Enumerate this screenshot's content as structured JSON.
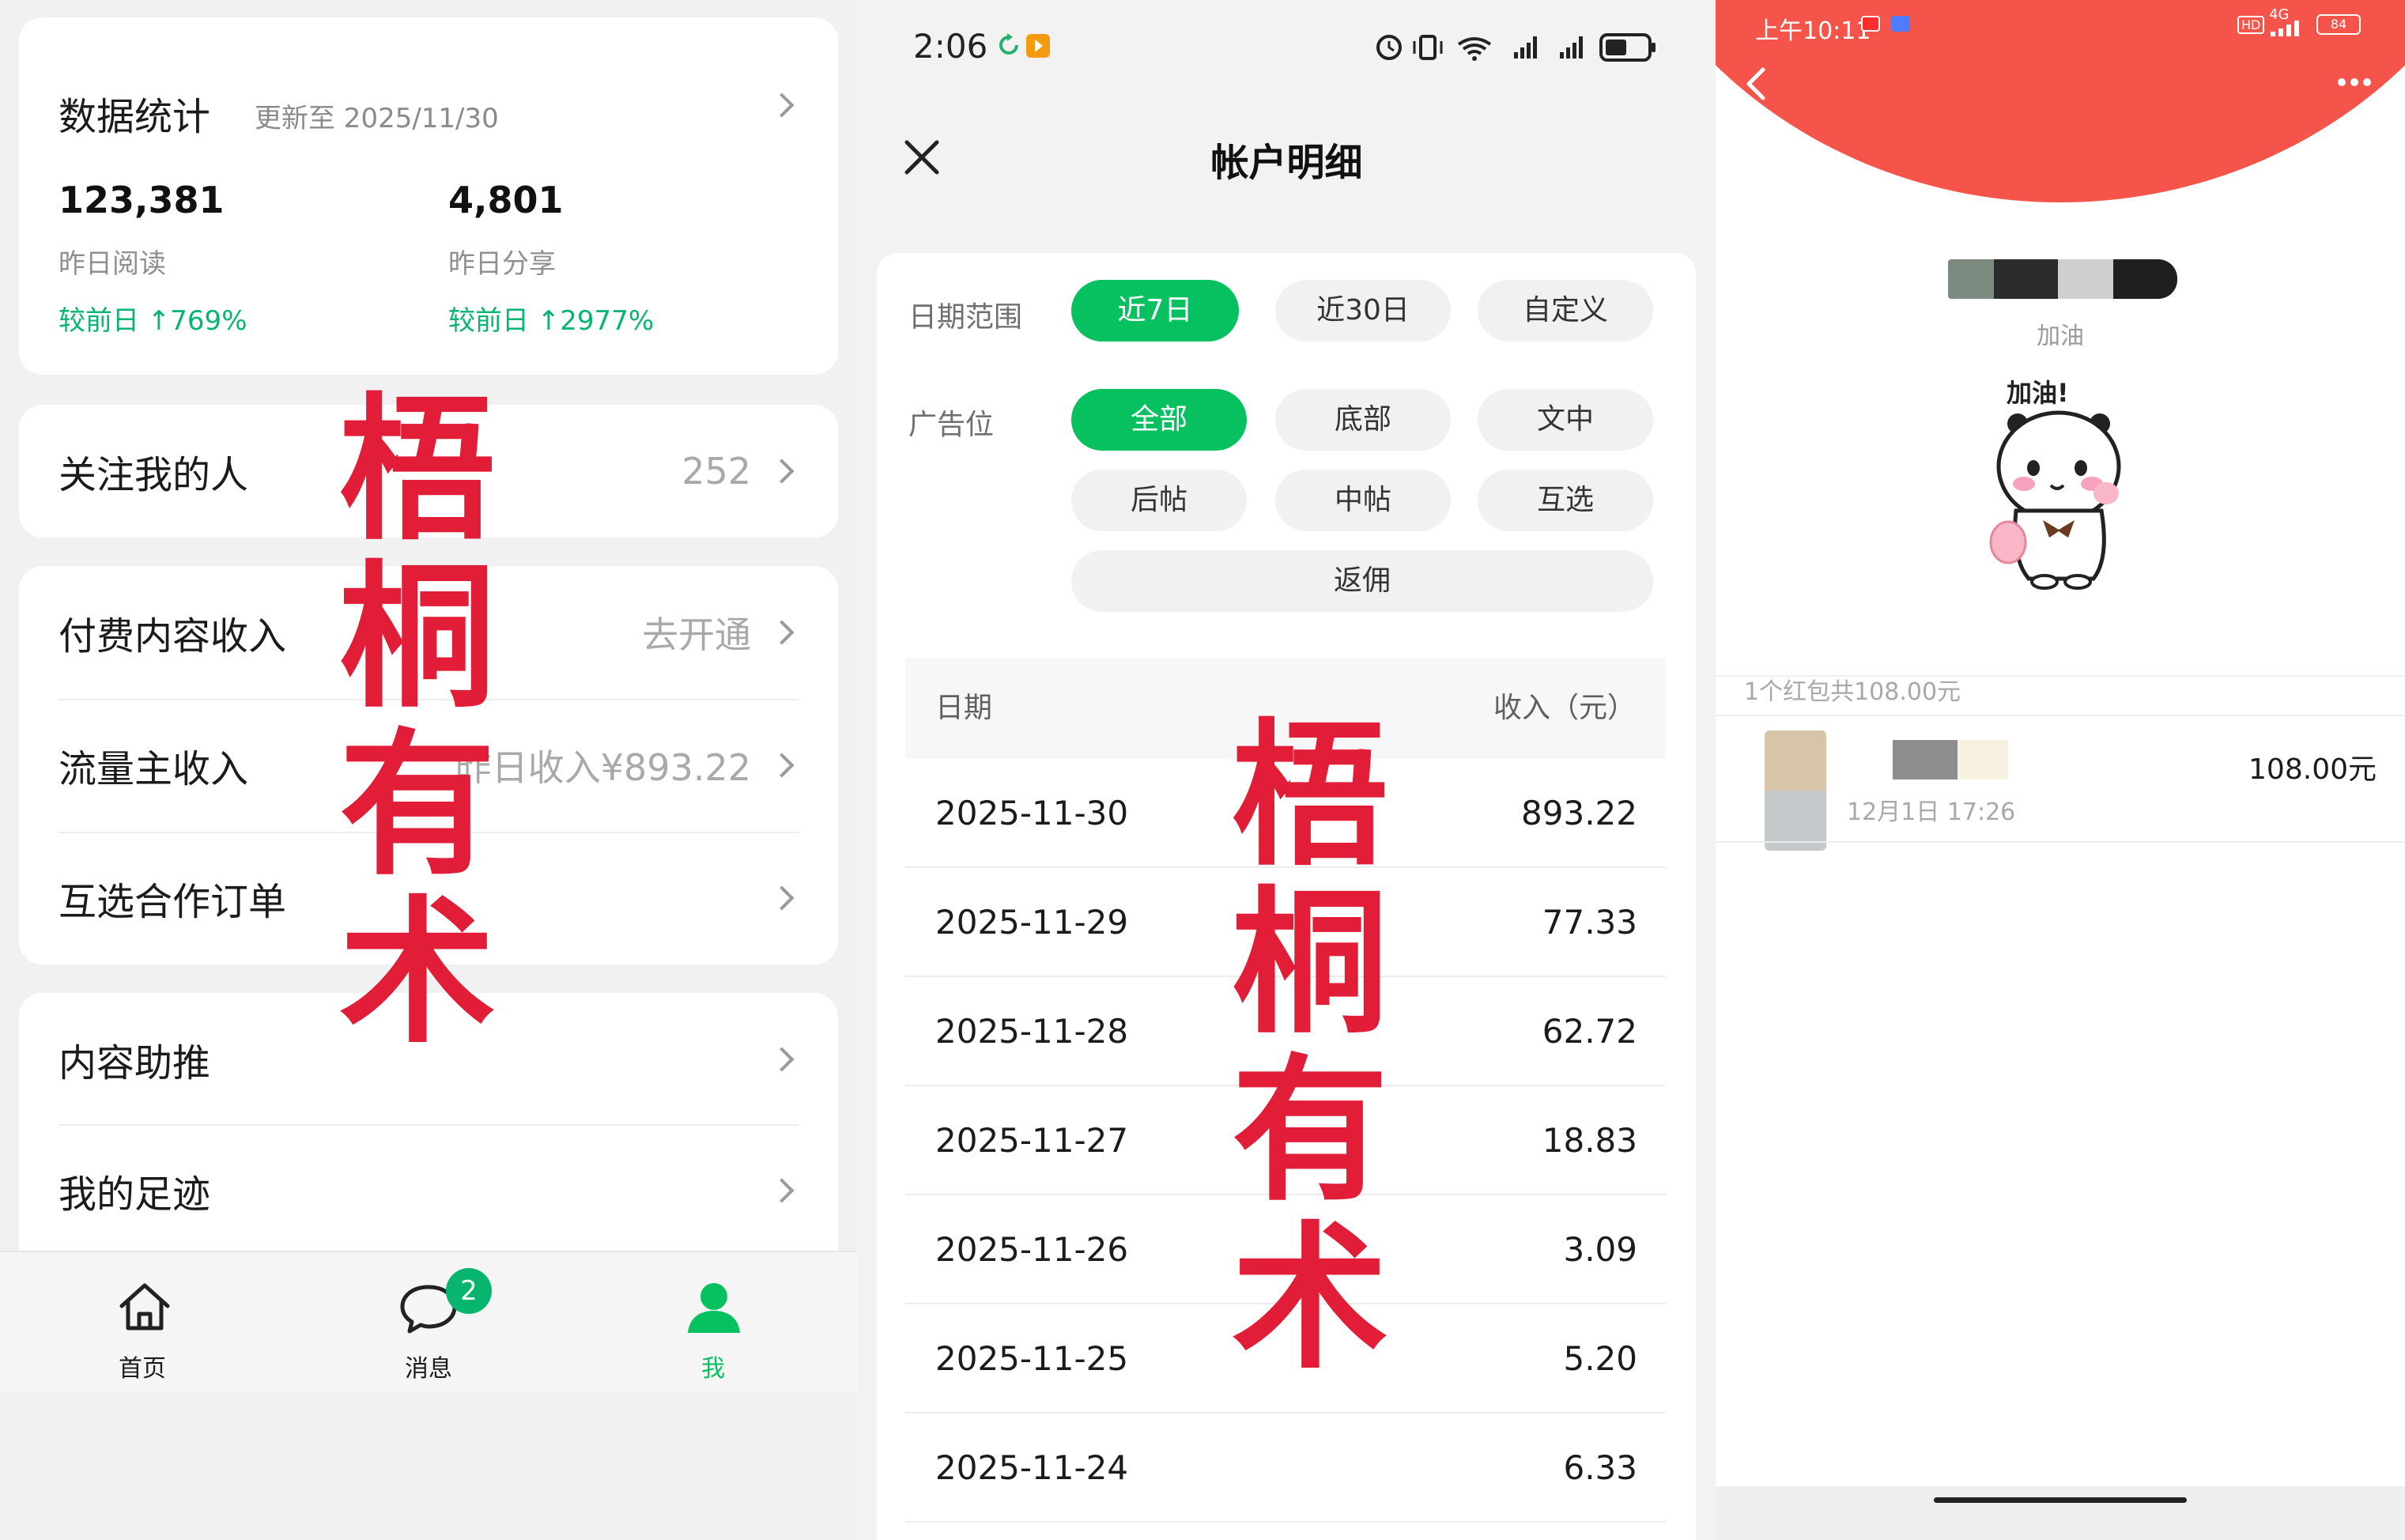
{
  "panel1": {
    "stats": {
      "title": "数据统计",
      "updated": "更新至 2025/11/30",
      "read_value": "123,381",
      "read_label": "昨日阅读",
      "read_change": "较前日 ↑769%",
      "share_value": "4,801",
      "share_label": "昨日分享",
      "share_change": "较前日 ↑2977%"
    },
    "followers": {
      "label": "关注我的人",
      "value": "252"
    },
    "paid": {
      "label": "付费内容收入",
      "value": "去开通"
    },
    "traffic": {
      "label": "流量主收入",
      "value": "昨日收入¥893.22"
    },
    "coop": {
      "label": "互选合作订单"
    },
    "promo": {
      "label": "内容助推"
    },
    "footprint": {
      "label": "我的足迹"
    },
    "tabs": {
      "home": "首页",
      "messages": "消息",
      "messages_badge": "2",
      "me": "我"
    },
    "watermark": [
      "梧",
      "桐",
      "有",
      "术"
    ]
  },
  "panel2": {
    "status_time": "2:06",
    "title": "帐户明细",
    "date_label": "日期范围",
    "date_chips": [
      "近7日",
      "近30日",
      "自定义"
    ],
    "ad_label": "广告位",
    "ad_chips": [
      "全部",
      "底部",
      "文中",
      "后帖",
      "中帖",
      "互选",
      "返佣"
    ],
    "table_header": {
      "date": "日期",
      "income": "收入（元）"
    },
    "rows": [
      {
        "date": "2025-11-30",
        "income": "893.22"
      },
      {
        "date": "2025-11-29",
        "income": "77.33"
      },
      {
        "date": "2025-11-28",
        "income": "62.72"
      },
      {
        "date": "2025-11-27",
        "income": "18.83"
      },
      {
        "date": "2025-11-26",
        "income": "3.09"
      },
      {
        "date": "2025-11-25",
        "income": "5.20"
      },
      {
        "date": "2025-11-24",
        "income": "6.33"
      }
    ],
    "watermark": [
      "梧",
      "桐",
      "有",
      "术"
    ]
  },
  "panel3": {
    "status_time": "上午10:11",
    "network": "4G",
    "battery": "84",
    "greeting": "加油",
    "sticker_text": "加油!",
    "summary": "1个红包共108.00元",
    "amount": "108.00元",
    "time": "12月1日 17:26"
  },
  "colors": {
    "green": "#07c160",
    "red_packet": "#f5544a",
    "watermark": "#e11d37"
  }
}
